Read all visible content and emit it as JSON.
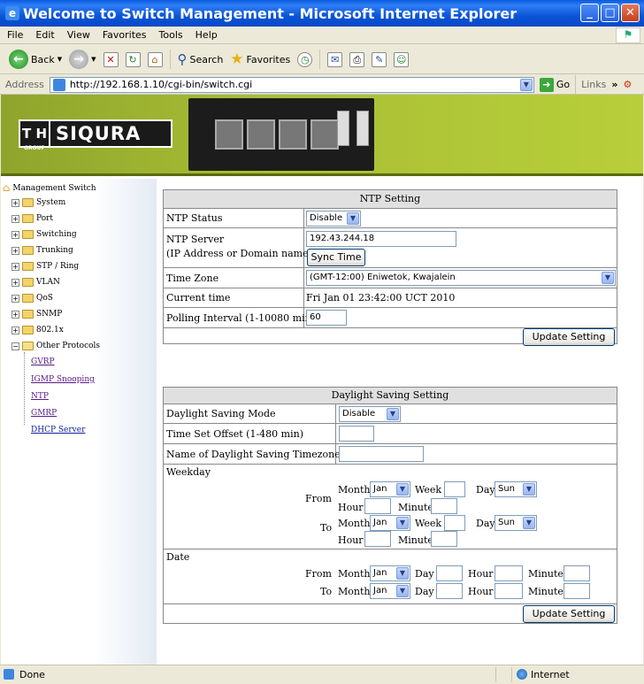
{
  "window": {
    "title": "Welcome to Switch Management - Microsoft Internet Explorer"
  },
  "menu": [
    "File",
    "Edit",
    "View",
    "Favorites",
    "Tools",
    "Help"
  ],
  "toolbar": {
    "back": "Back",
    "search": "Search",
    "favorites": "Favorites"
  },
  "address": {
    "label": "Address",
    "url": "http://192.168.1.10/cgi-bin/switch.cgi",
    "go": "Go",
    "links": "Links"
  },
  "banner": {
    "group_mark": "T H",
    "group_text": "GROUP",
    "brand": "SIQURA"
  },
  "sidebar": {
    "root": "Management Switch",
    "items": [
      "System",
      "Port",
      "Switching",
      "Trunking",
      "STP / Ring",
      "VLAN",
      "QoS",
      "SNMP",
      "802.1x"
    ],
    "open_item": "Other Protocols",
    "links": [
      "GVRP",
      "IGMP Snooping",
      "NTP",
      "GMRP",
      "DHCP Server"
    ]
  },
  "ntp": {
    "title": "NTP Setting",
    "status_label": "NTP Status",
    "status_value": "Disable",
    "server_label": "NTP Server",
    "server_sub": "(IP Address or Domain name)",
    "server_value": "192.43.244.18",
    "sync": "Sync Time",
    "tz_label": "Time Zone",
    "tz_value": "(GMT-12:00) Eniwetok, Kwajalein",
    "current_label": "Current time",
    "current_value": "Fri Jan 01 23:42:00 UCT 2010",
    "poll_label": "Polling Interval (1-10080 min)",
    "poll_value": "60",
    "update": "Update Setting"
  },
  "dst": {
    "title": "Daylight Saving Setting",
    "mode_label": "Daylight Saving Mode",
    "mode_value": "Disable",
    "offset_label": "Time Set Offset (1-480 min)",
    "name_label": "Name of Daylight Saving Timezone",
    "weekday_label": "Weekday",
    "date_label": "Date",
    "from": "From",
    "to": "To",
    "month": "Month",
    "week": "Week",
    "day": "Day",
    "hour": "Hour",
    "minute": "Minute",
    "month_value": "Jan",
    "day_value": "Sun",
    "update": "Update Setting"
  },
  "status": {
    "left": "Done",
    "right": "Internet"
  }
}
